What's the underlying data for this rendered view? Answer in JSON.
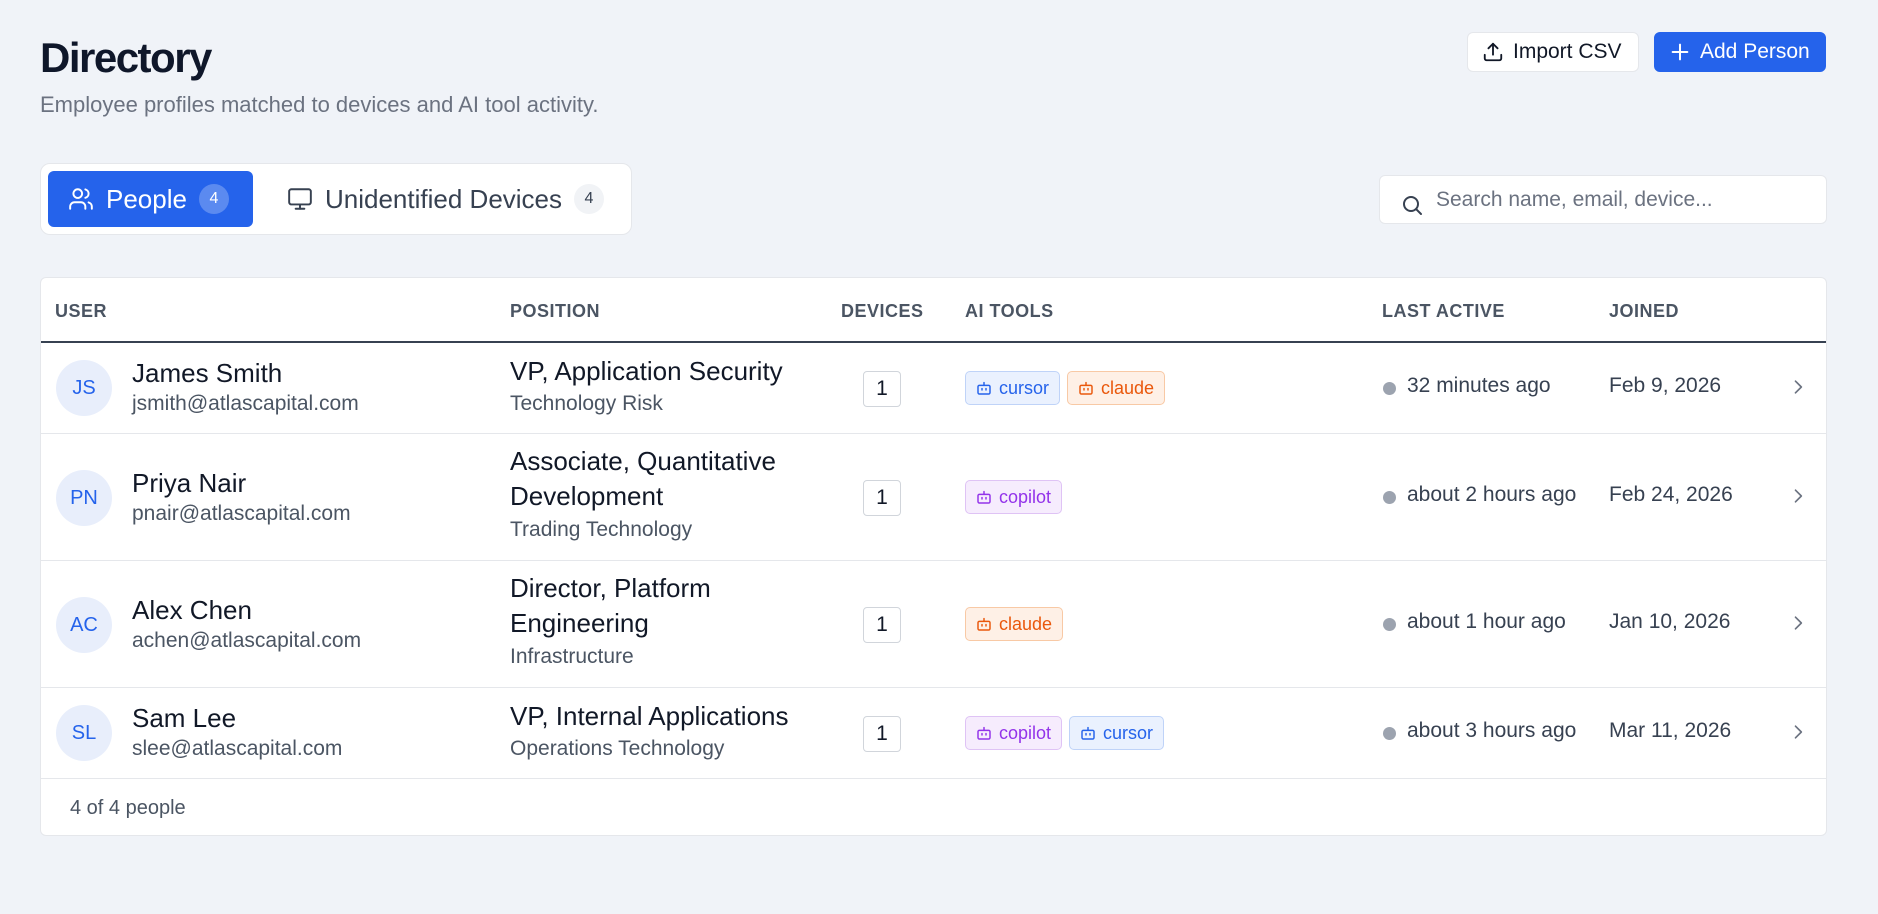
{
  "header": {
    "title": "Directory",
    "subtitle": "Employee profiles matched to devices and AI tool activity.",
    "import_label": "Import CSV",
    "add_label": "Add Person"
  },
  "tabs": [
    {
      "label": "People",
      "count": "4",
      "icon": "users-icon",
      "active": true
    },
    {
      "label": "Unidentified Devices",
      "count": "4",
      "icon": "monitor-icon",
      "active": false
    }
  ],
  "search": {
    "placeholder": "Search name, email, device...",
    "value": ""
  },
  "table": {
    "columns": [
      "USER",
      "POSITION",
      "DEVICES",
      "AI TOOLS",
      "LAST ACTIVE",
      "JOINED"
    ],
    "rows": [
      {
        "initials": "JS",
        "name": "James Smith",
        "email": "jsmith@atlascapital.com",
        "title": "VP, Application Security",
        "dept": "Technology Risk",
        "devices": "1",
        "tools": [
          "cursor",
          "claude"
        ],
        "last_active": "32 minutes ago",
        "joined": "Feb 9, 2026"
      },
      {
        "initials": "PN",
        "name": "Priya Nair",
        "email": "pnair@atlascapital.com",
        "title": "Associate, Quantitative Development",
        "dept": "Trading Technology",
        "devices": "1",
        "tools": [
          "copilot"
        ],
        "last_active": "about 2 hours ago",
        "joined": "Feb 24, 2026"
      },
      {
        "initials": "AC",
        "name": "Alex Chen",
        "email": "achen@atlascapital.com",
        "title": "Director, Platform Engineering",
        "dept": "Infrastructure",
        "devices": "1",
        "tools": [
          "claude"
        ],
        "last_active": "about 1 hour ago",
        "joined": "Jan 10, 2026"
      },
      {
        "initials": "SL",
        "name": "Sam Lee",
        "email": "slee@atlascapital.com",
        "title": "VP, Internal Applications",
        "dept": "Operations Technology",
        "devices": "1",
        "tools": [
          "copilot",
          "cursor"
        ],
        "last_active": "about 3 hours ago",
        "joined": "Mar 11, 2026"
      }
    ],
    "footer": "4 of 4 people"
  },
  "colors": {
    "accent": "#2563eb",
    "cursor": "#2563eb",
    "claude": "#ea580c",
    "copilot": "#9333ea",
    "background": "#f0f3f8"
  }
}
